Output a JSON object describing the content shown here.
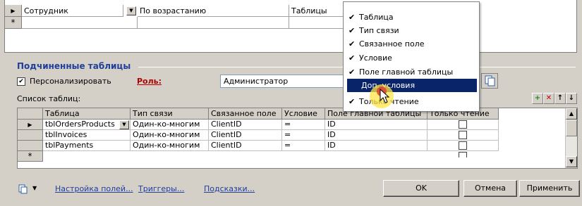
{
  "sort_grid": {
    "rows": [
      {
        "field": "Сотрудник",
        "order": "По возрастанию",
        "source": "Таблицы"
      }
    ],
    "new_row_marker": "*"
  },
  "subtables": {
    "title": "Подчиненные таблицы",
    "personalize_label": "Персонализировать",
    "personalize_checked": true,
    "role_label": "Роль:",
    "role_value": "Администратор",
    "list_label": "Список таблиц:",
    "columns": [
      "Таблица",
      "Тип связи",
      "Связанное поле",
      "Условие",
      "Поле главной таблицы",
      "Только чтение"
    ],
    "rows": [
      {
        "table": "tblOrdersProducts",
        "link_type": "Один-ко-многим",
        "field": "ClientID",
        "condition": "=",
        "main_field": "ID",
        "readonly": false
      },
      {
        "table": "tblInvoices",
        "link_type": "Один-ко-многим",
        "field": "ClientID",
        "condition": "=",
        "main_field": "ID",
        "readonly": false
      },
      {
        "table": "tblPayments",
        "link_type": "Один-ко-многим",
        "field": "ClientID",
        "condition": "=",
        "main_field": "ID",
        "readonly": false
      }
    ],
    "new_row_marker": "*"
  },
  "column_menu": {
    "items": [
      {
        "label": "Таблица",
        "checked": true,
        "selected": false
      },
      {
        "label": "Тип связи",
        "checked": true,
        "selected": false
      },
      {
        "label": "Связанное поле",
        "checked": true,
        "selected": false
      },
      {
        "label": "Условие",
        "checked": true,
        "selected": false
      },
      {
        "label": "Поле главной таблицы",
        "checked": true,
        "selected": false
      },
      {
        "label": "Доп. условия",
        "checked": false,
        "selected": true
      },
      {
        "label": "Только чтение",
        "checked": true,
        "selected": false
      }
    ]
  },
  "footer": {
    "links": [
      "Настройка полей...",
      "Триггеры...",
      "Подсказки..."
    ],
    "ok": "OK",
    "cancel": "Отмена",
    "apply": "Применить"
  }
}
